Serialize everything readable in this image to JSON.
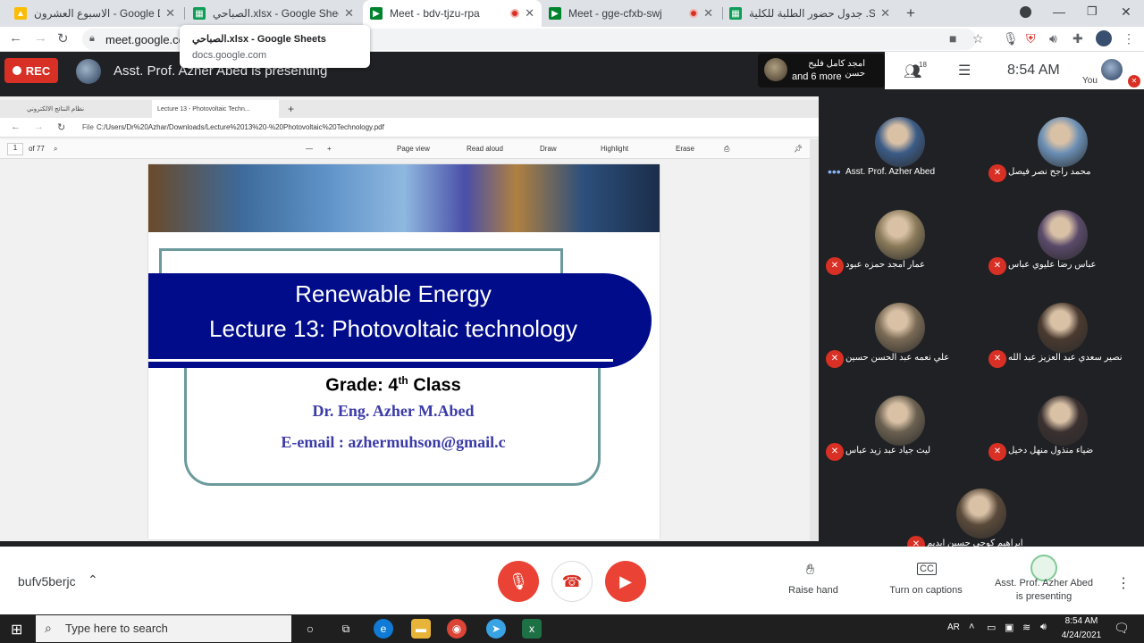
{
  "browser": {
    "tabs": [
      {
        "title": "الاسبوع العشرون - Google Drive",
        "icon": "google-drive-icon",
        "color": "#1a73e8"
      },
      {
        "title": "الصباحي.xlsx - Google Sheets",
        "icon": "google-sheets-icon",
        "color": "#0f9d58"
      },
      {
        "title": "Meet - bdv-tjzu-rpa",
        "icon": "google-meet-icon",
        "color": "#00832d"
      },
      {
        "title": "Meet - gge-cfxb-swj",
        "icon": "google-meet-icon",
        "color": "#00832d"
      },
      {
        "title": "جدول حضور الطلبة للكلية .Sheets",
        "icon": "google-sheets-icon",
        "color": "#0f9d58"
      }
    ],
    "url": "meet.google.com",
    "tooltip": {
      "title": "الصباحي.xlsx - Google Sheets",
      "domain": "docs.google.com"
    }
  },
  "meet": {
    "rec_label": "REC",
    "presenting_banner": "Asst. Prof. Azher Abed is presenting",
    "speaker_name": "امجد كامل فليح حسن",
    "speaker_more": "and 6 more",
    "people_count": "18",
    "time": "8:54 AM",
    "you_label": "You",
    "meeting_code": "bufv5berjc"
  },
  "presented": {
    "edge_tabs": [
      "نظام النتائج الالكتروني",
      "Lecture 13 - Photovoltaic Techn..."
    ],
    "file_label": "File",
    "file_path": "C:/Users/Dr%20Azhar/Downloads/Lecture%2013%20-%20Photovoltaic%20Technology.pdf",
    "page_current": "1",
    "page_total": "of 77",
    "toolbar": [
      "Page view",
      "Read aloud",
      "Draw",
      "Highlight",
      "Erase"
    ],
    "slide": {
      "title1": "Renewable Energy",
      "title2": "Lecture 13: Photovoltaic technology",
      "grade": "Grade:",
      "grade_num": "4",
      "grade_sup": "th",
      "grade_class": "Class",
      "author": "Dr. Eng. Azher M.Abed",
      "email": "E-email : azhermuhson@gmail.c"
    }
  },
  "participants": [
    {
      "name": "Asst. Prof. Azher Abed",
      "muted": false,
      "avatar": "#3b5b86"
    },
    {
      "name": "محمد راجح نصر فيصل",
      "muted": true,
      "avatar": "#6a8fb5"
    },
    {
      "name": "عمار امجد حمزه عبود",
      "muted": true,
      "avatar": "#8a7a5a"
    },
    {
      "name": "عباس رضا عليوي عباس",
      "muted": true,
      "avatar": "#5a4a6a"
    },
    {
      "name": "علي نعمه عبد الحسن حسين",
      "muted": true,
      "avatar": "#7a6a55"
    },
    {
      "name": "نصير سعدي عبد العزيز عبد الله",
      "muted": true,
      "avatar": "#4a3a30"
    },
    {
      "name": "ليث جياد عبد زيد عباس",
      "muted": true,
      "avatar": "#6a6050"
    },
    {
      "name": "ضياء منذول منهل دخيل",
      "muted": true,
      "avatar": "#3a3030"
    },
    {
      "name": "ابراهيم كوجي حسين ابديم",
      "muted": true,
      "avatar": "#5a4a3a"
    }
  ],
  "controls": {
    "raise_hand": "Raise hand",
    "captions": "Turn on captions",
    "presenting_line1": "Asst. Prof. Azher Abed",
    "presenting_line2": "is presenting"
  },
  "taskbar": {
    "search_placeholder": "Type here to search",
    "lang": "AR",
    "time": "8:54 AM",
    "date": "4/24/2021"
  }
}
